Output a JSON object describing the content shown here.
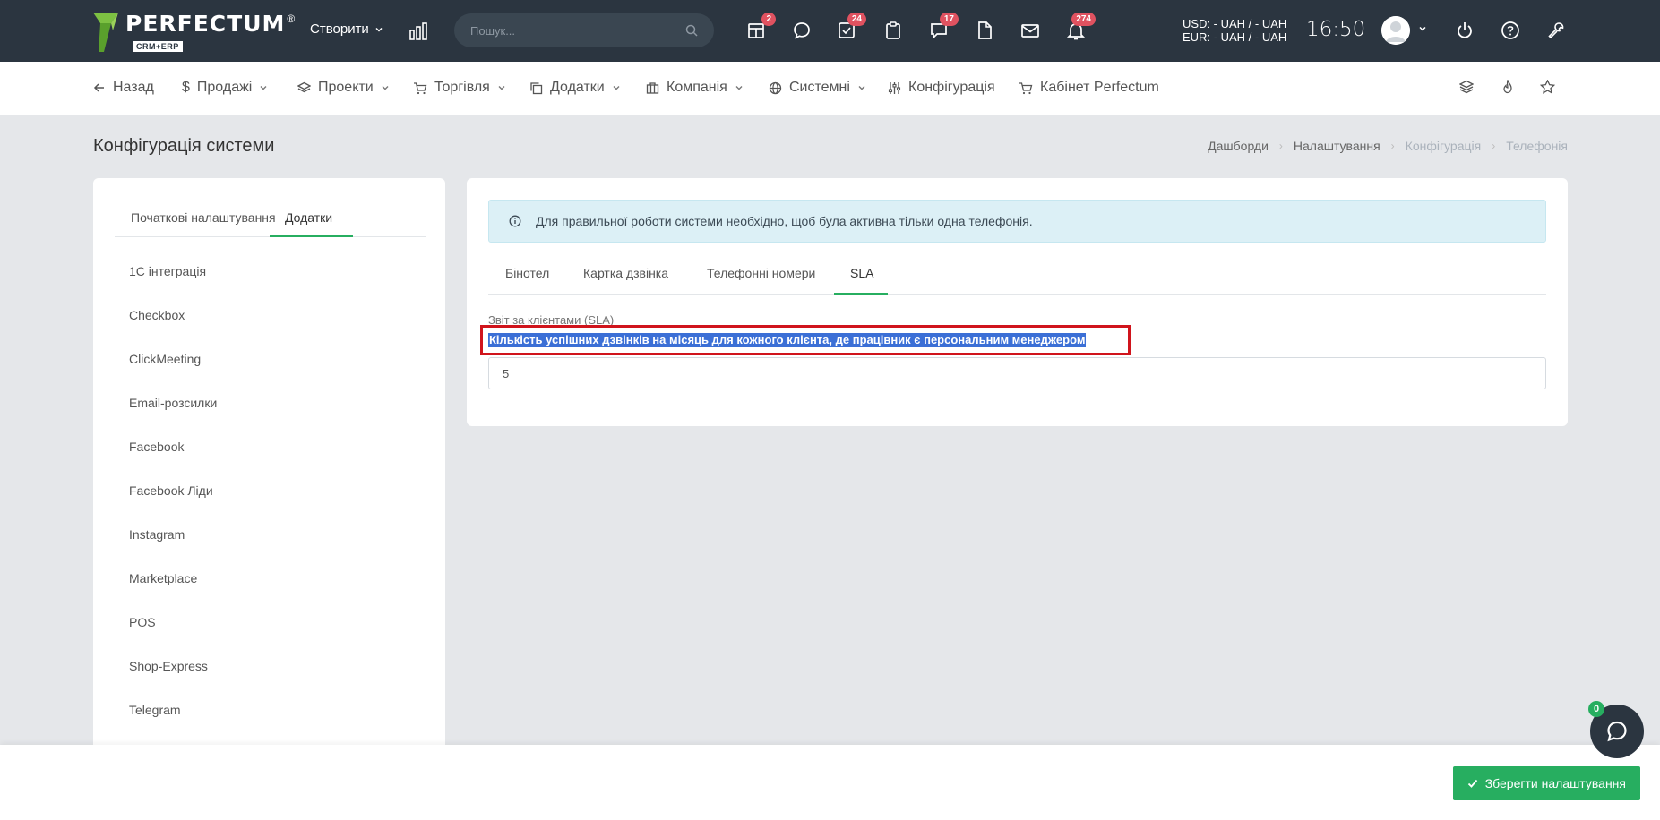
{
  "topbar": {
    "logo_text": "PERFECTUM",
    "logo_sub": "CRM+ERP",
    "logo_reg": "®",
    "create_label": "Створити",
    "search_placeholder": "Пошук...",
    "icons": [
      {
        "name": "calendar-icon",
        "badge": "2"
      },
      {
        "name": "chat-icon",
        "badge": ""
      },
      {
        "name": "tasks-icon",
        "badge": "24"
      },
      {
        "name": "clipboard-icon",
        "badge": ""
      },
      {
        "name": "comments-icon",
        "badge": "17"
      },
      {
        "name": "document-icon",
        "badge": ""
      },
      {
        "name": "mail-icon",
        "badge": ""
      },
      {
        "name": "bell-icon",
        "badge": "274"
      }
    ],
    "usd": "USD: - UAH / - UAH",
    "eur": "EUR: - UAH / - UAH",
    "time": "16:50"
  },
  "nav": {
    "back": "Назад",
    "sales": "Продажі",
    "projects": "Проекти",
    "trade": "Торгівля",
    "addons": "Додатки",
    "company": "Компанія",
    "system": "Системні",
    "config": "Конфігурація",
    "cabinet": "Кабінет Perfectum"
  },
  "page": {
    "title": "Конфігурація системи",
    "breadcrumb": [
      "Дашборди",
      "Налаштування",
      "Конфігурація",
      "Телефонія"
    ]
  },
  "left": {
    "tabs": [
      "Початкові налаштування",
      "Додатки"
    ],
    "active_tab": "Додатки",
    "items": [
      "1С інтеграція",
      "Checkbox",
      "ClickMeeting",
      "Email-розсилки",
      "Facebook",
      "Facebook Ліди",
      "Instagram",
      "Marketplace",
      "POS",
      "Shop-Express",
      "Telegram"
    ]
  },
  "main": {
    "alert": "Для правильної роботи системи необхідно, щоб була активна тільки одна телефонія.",
    "tabs": [
      "Бінотел",
      "Картка дзвінка",
      "Телефонні номери",
      "SLA"
    ],
    "active_tab": "SLA",
    "section_label": "Звіт за клієнтами (SLA)",
    "field_label": "Кількість успішних дзвінків на місяць для кожного клієнта, де працівник є персональним менеджером",
    "field_value": "5"
  },
  "footer": {
    "save_label": "Зберегти налаштування"
  },
  "chat": {
    "badge": "0"
  },
  "colors": {
    "topbar": "#2b3540",
    "accent": "#27ae60",
    "badge": "#e05260",
    "alert_bg": "#dcf0f6",
    "highlight": "#d0141c",
    "selection": "#3b6fd6"
  }
}
